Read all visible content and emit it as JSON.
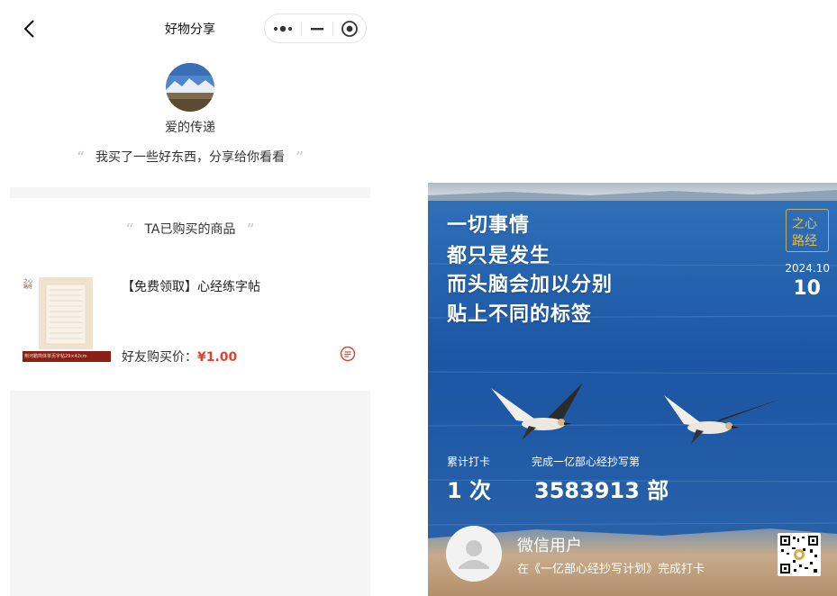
{
  "navbar": {
    "title": "好物分享",
    "back_icon": "chevron-left-icon",
    "capsule": {
      "more_icon": "more-dots-icon",
      "minimize_icon": "minimize-icon",
      "close_icon": "record-icon"
    }
  },
  "profile": {
    "name": "爱的传递",
    "quote": "我买了一些好东西，分享给你看看",
    "quote_open": "“",
    "quote_close": "”"
  },
  "section": {
    "title": "TA已购买的商品"
  },
  "product": {
    "title": "【免费领取】心经练字帖",
    "price_label": "好友购买价：",
    "price": "¥1.00",
    "thumb_badge": "之心路经",
    "thumb_caption": "荆河鹏简体单页字帖29×42cm",
    "action_icon": "chat-bubble-icon"
  },
  "poster": {
    "quote_lines": [
      "一切事情",
      "都只是发生",
      "而头脑会加以分别",
      "贴上不同的标签"
    ],
    "stamp_line1": "之心",
    "stamp_line2": "路经",
    "date_ym": "2024.10",
    "date_day": "10",
    "stat_left_label": "累计打卡",
    "stat_left_value": "1 次",
    "stat_right_label": "完成一亿部心经抄写第",
    "stat_right_value": "3583913 部",
    "user_name": "微信用户",
    "user_sub": "在《一亿部心经抄写计划》完成打卡",
    "qr_icon": "qr-code-icon",
    "colors": {
      "sky": "#c9d3da",
      "sea": "#1f58a8",
      "sand": "#c8a786",
      "accent_gold": "#e6c04a"
    }
  }
}
